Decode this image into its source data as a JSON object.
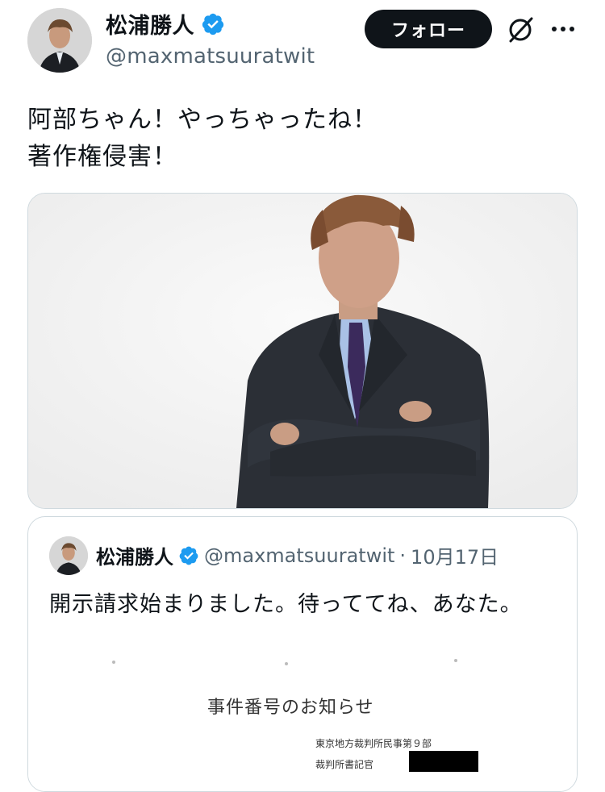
{
  "author": {
    "name": "松浦勝人",
    "handle": "@maxmatsuuratwit",
    "avatar_icon": "avatar-photo",
    "verified_icon": "verified-badge-icon",
    "verified_color": "#1d9bf0"
  },
  "header": {
    "follow_label": "フォロー",
    "grok_icon": "grok-icon",
    "more_icon": "more-dots-icon"
  },
  "tweet": {
    "line1": "阿部ちゃん！やっちゃったね！",
    "line2": "著作権侵害！"
  },
  "media": {
    "description_icon": "photo-of-man-in-suit"
  },
  "quote": {
    "name": "松浦勝人",
    "handle": "@maxmatsuuratwit",
    "separator": "·",
    "date": "10月17日",
    "text": "開示請求始まりました。待っててね、あなた。",
    "document": {
      "title": "事件番号のお知らせ",
      "court": "東京地方裁判所民事第９部",
      "clerk": "裁判所書記官"
    }
  },
  "colors": {
    "text": "#0f1419",
    "secondary": "#536471",
    "border": "#cfd9de",
    "button_bg": "#0f1419"
  }
}
